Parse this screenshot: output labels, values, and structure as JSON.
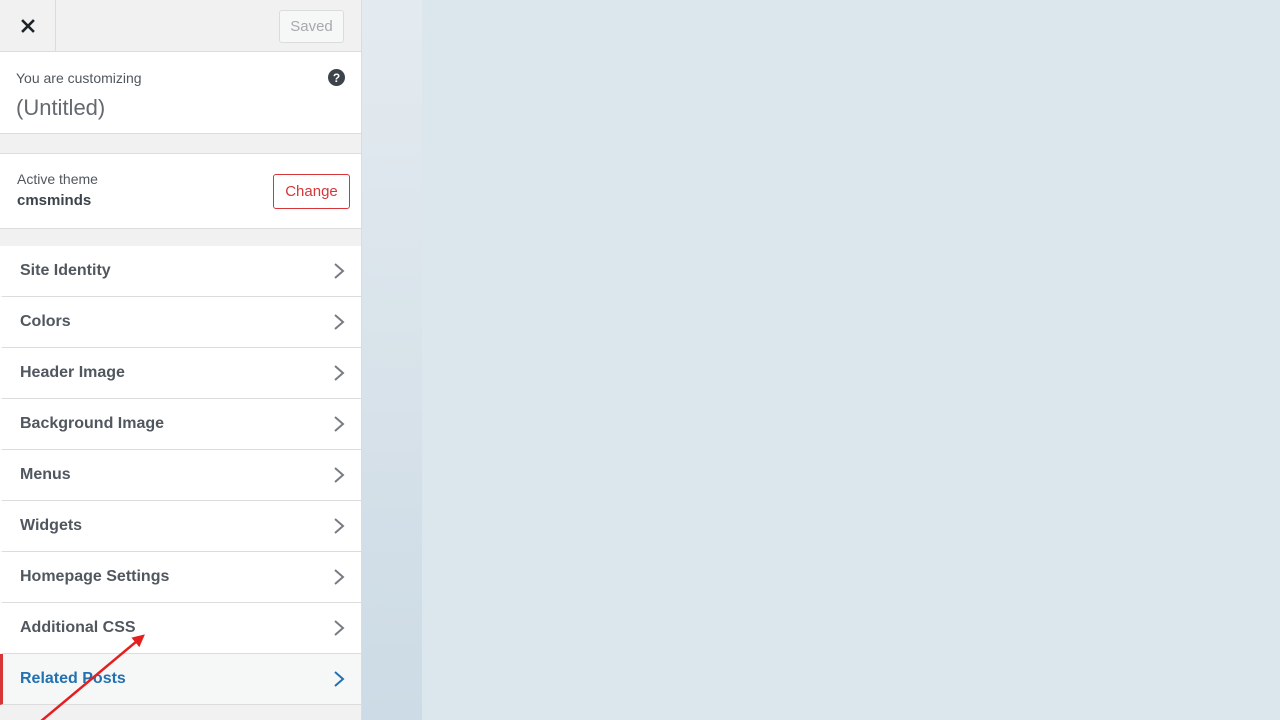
{
  "header": {
    "close_icon": "close-icon",
    "saved_label": "Saved"
  },
  "info": {
    "label": "You are customizing",
    "title": "(Untitled)",
    "help_icon": "question-circle-icon",
    "help_glyph": "?"
  },
  "theme": {
    "label": "Active theme",
    "name": "cmsminds",
    "change_label": "Change"
  },
  "menu": {
    "items": [
      {
        "label": "Site Identity"
      },
      {
        "label": "Colors"
      },
      {
        "label": "Header Image"
      },
      {
        "label": "Background Image"
      },
      {
        "label": "Menus"
      },
      {
        "label": "Widgets"
      },
      {
        "label": "Homepage Settings"
      },
      {
        "label": "Additional CSS"
      },
      {
        "label": "Related Posts"
      }
    ],
    "active_index": 8
  },
  "colors": {
    "accent": "#2271b1",
    "danger": "#d63638",
    "annotation": "#e41f1f"
  }
}
